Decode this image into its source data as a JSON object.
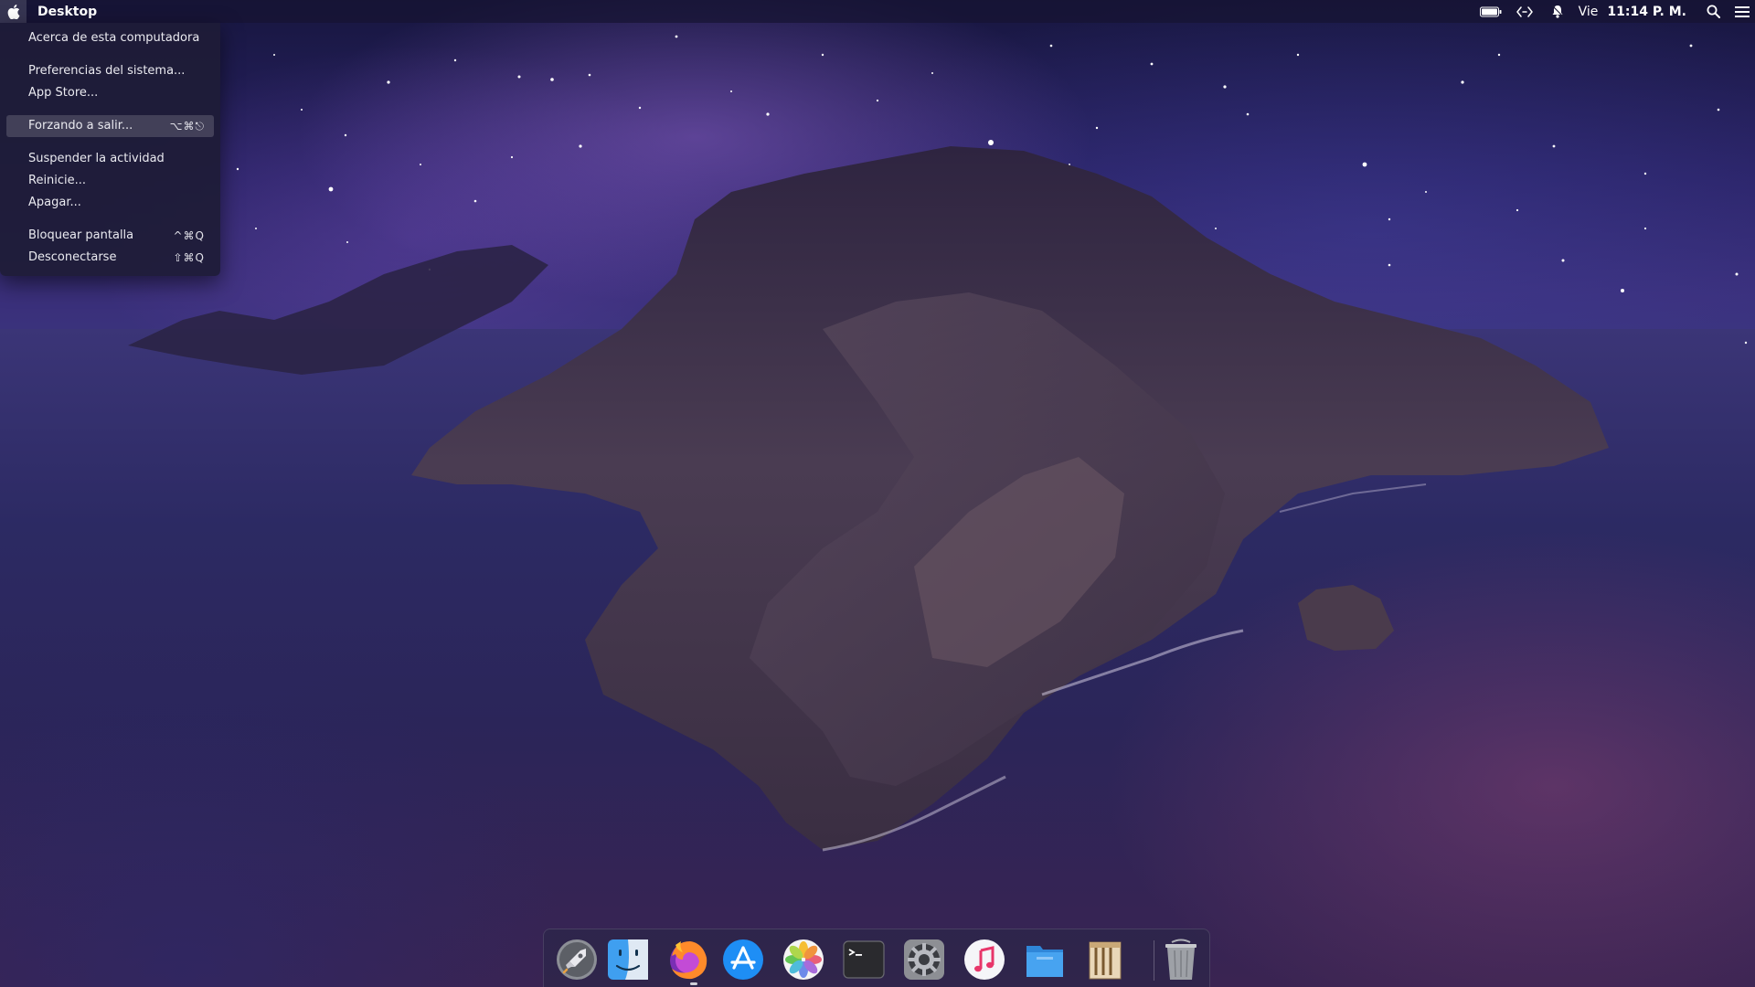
{
  "menubar": {
    "app_name": "Desktop",
    "day": "Vie",
    "time": "11:14 P. M.",
    "status_icons": [
      "battery-icon",
      "code-arrows-icon",
      "notification-bell-icon",
      "spotlight-search-icon",
      "notification-center-icon"
    ]
  },
  "apple_menu": {
    "items": [
      {
        "label": "Acerca de esta computadora",
        "shortcut": ""
      },
      {
        "label": "Preferencias del sistema...",
        "shortcut": ""
      },
      {
        "label": "App Store...",
        "shortcut": ""
      },
      {
        "label": "Forzando a salir...",
        "shortcut": "⌥⌘⎋",
        "highlighted": true
      },
      {
        "label": "Suspender la actividad",
        "shortcut": ""
      },
      {
        "label": "Reinicie...",
        "shortcut": ""
      },
      {
        "label": "Apagar...",
        "shortcut": ""
      },
      {
        "label": "Bloquear pantalla",
        "shortcut": "^⌘Q"
      },
      {
        "label": "Desconectarse",
        "shortcut": "⇧⌘Q"
      }
    ]
  },
  "dock": {
    "items": [
      {
        "name": "launchpad-icon"
      },
      {
        "name": "finder-icon"
      },
      {
        "name": "firefox-icon",
        "running": true
      },
      {
        "name": "app-store-icon"
      },
      {
        "name": "photos-icon"
      },
      {
        "name": "terminal-icon"
      },
      {
        "name": "system-preferences-icon"
      },
      {
        "name": "music-icon"
      },
      {
        "name": "files-icon"
      },
      {
        "name": "archive-icon"
      },
      {
        "name": "trash-icon"
      }
    ]
  },
  "colors": {
    "menu_bg": "#1e1c37",
    "menu_highlight": "#4a4862",
    "sky_dark": "#17163f",
    "sea": "#2b2559"
  }
}
